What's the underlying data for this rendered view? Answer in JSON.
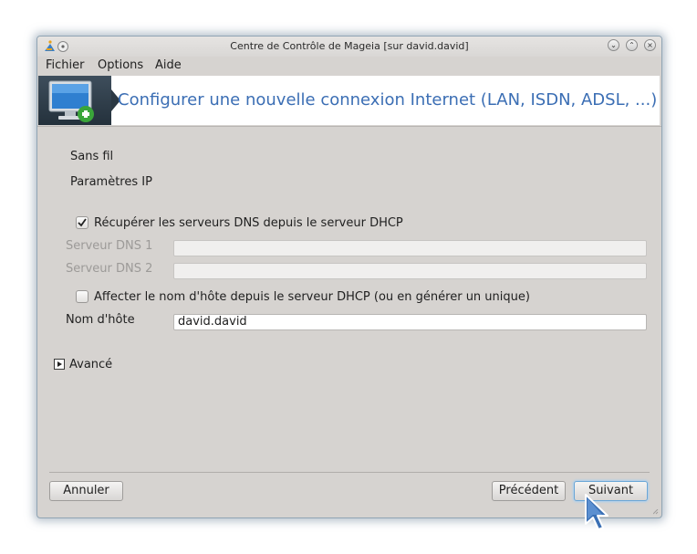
{
  "window": {
    "title": "Centre de Contrôle de Mageia  [sur david.david]"
  },
  "menu": [
    {
      "label": "Fichier"
    },
    {
      "label": "Options"
    },
    {
      "label": "Aide"
    }
  ],
  "banner": {
    "title": "Configurer une nouvelle connexion Internet (LAN, ISDN, ADSL, ...)",
    "icon": "network-monitor-add-icon"
  },
  "sections": {
    "wireless_label": "Sans fil",
    "ip_params_label": "Paramètres IP"
  },
  "dns_dhcp": {
    "label": "Récupérer les serveurs DNS depuis le serveur DHCP",
    "checked": true
  },
  "dns1": {
    "label": "Serveur DNS 1",
    "value": ""
  },
  "dns2": {
    "label": "Serveur DNS 2",
    "value": ""
  },
  "hostname_dhcp": {
    "label": "Affecter le nom d'hôte depuis le serveur DHCP (ou en générer un unique)",
    "checked": false
  },
  "hostname": {
    "label": "Nom d'hôte",
    "value": "david.david"
  },
  "advanced": {
    "label": "Avancé",
    "expanded": false
  },
  "buttons": {
    "cancel": "Annuler",
    "previous": "Précédent",
    "next": "Suivant"
  }
}
